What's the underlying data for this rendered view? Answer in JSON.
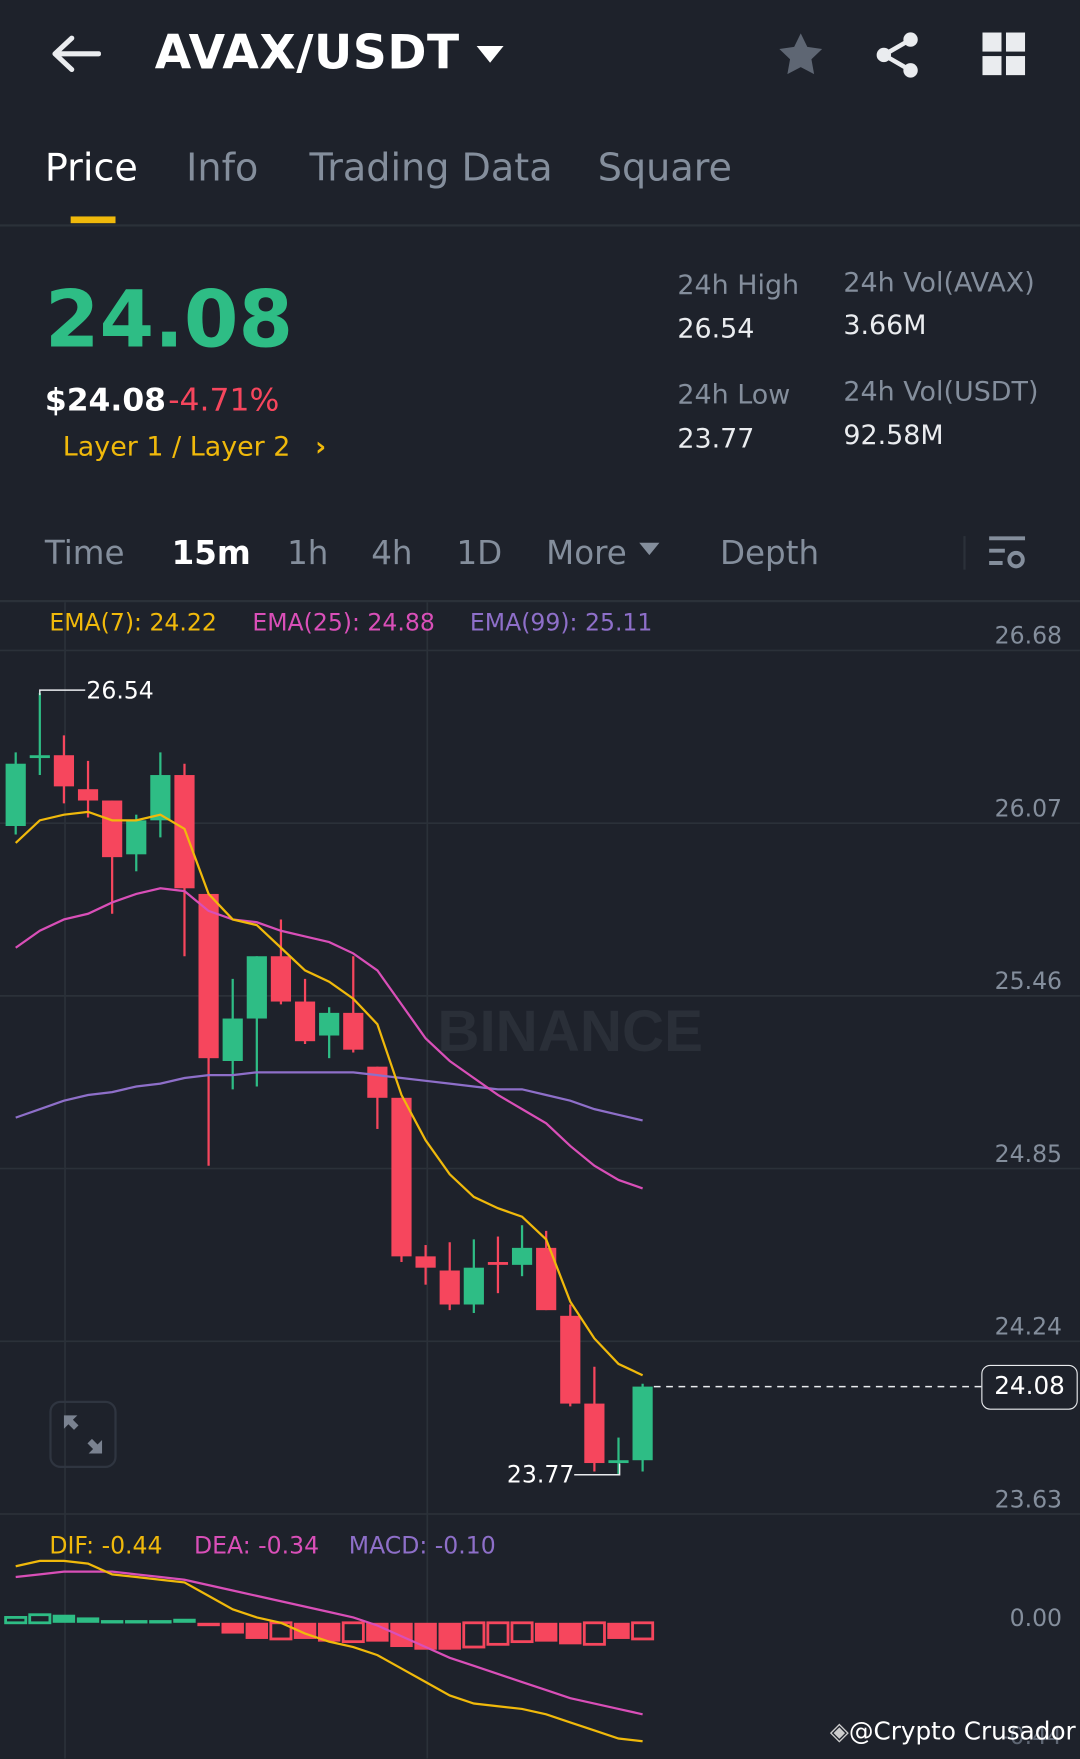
{
  "header": {
    "title": "AVAX/USDT",
    "back_icon": "arrow-left-icon",
    "favorite_icon": "star-icon",
    "share_icon": "share-icon",
    "menu_icon": "grid-icon"
  },
  "tabs": [
    {
      "label": "Price",
      "active": true
    },
    {
      "label": "Info"
    },
    {
      "label": "Trading Data"
    },
    {
      "label": "Square"
    }
  ],
  "price": {
    "last": "24.08",
    "usd": "$24.08",
    "change": "-4.71%",
    "category": "Layer 1 / Layer 2",
    "category_chevron": "›"
  },
  "stats": {
    "high_label": "24h High",
    "high": "26.54",
    "low_label": "24h Low",
    "low": "23.77",
    "vol_base_label": "24h Vol(AVAX)",
    "vol_base": "3.66M",
    "vol_quote_label": "24h Vol(USDT)",
    "vol_quote": "92.58M"
  },
  "intervals": {
    "items": [
      "Time",
      "15m",
      "1h",
      "4h",
      "1D"
    ],
    "active": "15m",
    "more": "More",
    "depth": "Depth"
  },
  "colors": {
    "up": "#2ebd85",
    "down": "#f6465d",
    "ema7": "#f0b90b",
    "ema25": "#d94fb8",
    "ema99": "#8e6fc9",
    "accent": "#f0b90b"
  },
  "indicators": {
    "ema7": "EMA(7): 24.22",
    "ema25": "EMA(25): 24.88",
    "ema99": "EMA(99): 25.11",
    "dif": "DIF: -0.44",
    "dea": "DEA: -0.34",
    "macd": "MACD: -0.10"
  },
  "watermark": "BINANCE",
  "credit": "@Crypto Crusador",
  "chart_data": {
    "type": "candlestick",
    "interval": "15m",
    "price_axis": [
      "26.68",
      "26.07",
      "25.46",
      "24.85",
      "24.24",
      "23.63"
    ],
    "ylim": [
      23.63,
      26.68
    ],
    "max_label": "26.54",
    "min_label": "23.77",
    "last_label": "24.08",
    "candles": [
      [
        26.06,
        26.32,
        26.03,
        26.28
      ],
      [
        26.3,
        26.53,
        26.24,
        26.31
      ],
      [
        26.31,
        26.38,
        26.14,
        26.2
      ],
      [
        26.19,
        26.29,
        26.09,
        26.15
      ],
      [
        26.15,
        26.15,
        25.75,
        25.95
      ],
      [
        25.96,
        26.1,
        25.9,
        26.08
      ],
      [
        26.08,
        26.32,
        26.02,
        26.24
      ],
      [
        26.24,
        26.28,
        25.6,
        25.84
      ],
      [
        25.82,
        25.82,
        24.86,
        25.24
      ],
      [
        25.23,
        25.52,
        25.13,
        25.38
      ],
      [
        25.38,
        25.6,
        25.14,
        25.6
      ],
      [
        25.6,
        25.73,
        25.43,
        25.44
      ],
      [
        25.44,
        25.52,
        25.29,
        25.3
      ],
      [
        25.32,
        25.42,
        25.24,
        25.4
      ],
      [
        25.4,
        25.6,
        25.26,
        25.27
      ],
      [
        25.21,
        25.21,
        24.99,
        25.1
      ],
      [
        25.1,
        25.1,
        24.52,
        24.54
      ],
      [
        24.54,
        24.58,
        24.44,
        24.5
      ],
      [
        24.49,
        24.59,
        24.35,
        24.37
      ],
      [
        24.37,
        24.6,
        24.34,
        24.5
      ],
      [
        24.52,
        24.61,
        24.41,
        24.51
      ],
      [
        24.51,
        24.65,
        24.47,
        24.57
      ],
      [
        24.57,
        24.63,
        24.35,
        24.35
      ],
      [
        24.33,
        24.37,
        24.01,
        24.02
      ],
      [
        24.02,
        24.15,
        23.78,
        23.81
      ],
      [
        23.81,
        23.9,
        23.77,
        23.82
      ],
      [
        23.82,
        24.09,
        23.78,
        24.08
      ]
    ],
    "ema7": [
      26.0,
      26.08,
      26.1,
      26.11,
      26.08,
      26.08,
      26.1,
      26.05,
      25.82,
      25.73,
      25.71,
      25.63,
      25.55,
      25.51,
      25.45,
      25.36,
      25.11,
      24.95,
      24.83,
      24.75,
      24.71,
      24.68,
      24.6,
      24.38,
      24.25,
      24.16,
      24.12
    ],
    "ema25": [
      25.63,
      25.69,
      25.73,
      25.75,
      25.79,
      25.82,
      25.84,
      25.83,
      25.76,
      25.73,
      25.72,
      25.69,
      25.67,
      25.65,
      25.61,
      25.55,
      25.43,
      25.31,
      25.23,
      25.17,
      25.11,
      25.06,
      25.01,
      24.93,
      24.86,
      24.81,
      24.78
    ],
    "ema99": [
      25.03,
      25.06,
      25.09,
      25.11,
      25.12,
      25.14,
      25.15,
      25.17,
      25.18,
      25.18,
      25.19,
      25.19,
      25.19,
      25.19,
      25.19,
      25.18,
      25.17,
      25.16,
      25.15,
      25.14,
      25.13,
      25.13,
      25.11,
      25.09,
      25.06,
      25.04,
      25.02
    ],
    "macd_axis": [
      "0.00",
      "-0.44"
    ],
    "macd_hist": [
      0.02,
      0.03,
      0.03,
      0.02,
      0.01,
      0.01,
      0.01,
      0.015,
      -0.01,
      -0.04,
      -0.06,
      -0.06,
      -0.06,
      -0.07,
      -0.07,
      -0.07,
      -0.09,
      -0.1,
      -0.1,
      -0.09,
      -0.08,
      -0.07,
      -0.07,
      -0.08,
      -0.08,
      -0.06,
      -0.06
    ],
    "macd_hollow": [
      true,
      true,
      false,
      false,
      false,
      false,
      false,
      false,
      false,
      false,
      false,
      true,
      false,
      false,
      true,
      false,
      false,
      false,
      false,
      true,
      true,
      true,
      false,
      false,
      true,
      false,
      true
    ],
    "dif": [
      0.21,
      0.23,
      0.23,
      0.22,
      0.18,
      0.17,
      0.16,
      0.15,
      0.1,
      0.05,
      0.02,
      0.0,
      -0.04,
      -0.07,
      -0.09,
      -0.12,
      -0.17,
      -0.22,
      -0.27,
      -0.3,
      -0.31,
      -0.32,
      -0.34,
      -0.37,
      -0.4,
      -0.43,
      -0.44
    ],
    "dea": [
      0.17,
      0.18,
      0.19,
      0.19,
      0.19,
      0.18,
      0.17,
      0.16,
      0.14,
      0.12,
      0.1,
      0.08,
      0.06,
      0.04,
      0.02,
      -0.01,
      -0.05,
      -0.09,
      -0.13,
      -0.16,
      -0.19,
      -0.22,
      -0.25,
      -0.28,
      -0.3,
      -0.32,
      -0.34
    ]
  }
}
